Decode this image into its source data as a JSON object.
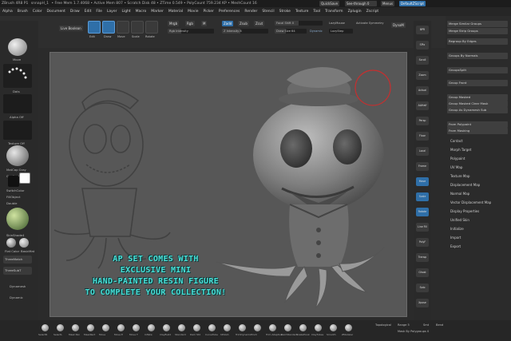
{
  "titlebar": {
    "app": "ZBrush 4R8 P1",
    "doc": "snnapH_1",
    "free_mem": "• Free Mem 1.7.4068 • Active Mem 807 • Scratch Disk 48 • ZTime 0.549 • PolyCount 759.234 KP • MeshCount 16",
    "quicksave": "QuickSave",
    "see_through": "See-through  0",
    "menus_label": "Menus",
    "script": "DefaultZScript"
  },
  "menubar": [
    "Alpha",
    "Brush",
    "Color",
    "Document",
    "Draw",
    "Edit",
    "File",
    "Layer",
    "Light",
    "Macro",
    "Marker",
    "Material",
    "Movie",
    "Picker",
    "Preferences",
    "Render",
    "Stencil",
    "Stroke",
    "Texture",
    "Tool",
    "Transform",
    "Zplugin",
    "Zscript"
  ],
  "toolbar": {
    "active_points": "ActivePoints: 14,921",
    "total_points": "TotalPoints: 759,176",
    "live_boolean": "Live Boolean",
    "edit": "Edit",
    "draw": "Draw",
    "move": "Move",
    "scale": "Scale",
    "rotate": "Rotate",
    "mrgb": "Mrgb",
    "rgb": "Rgb",
    "m": "M",
    "zadd": "Zadd",
    "zsub": "Zsub",
    "zcut": "Zcut",
    "rgb_intensity": "Rgb Intensity",
    "z_intensity": "Z Intensity  8",
    "focal_shift": "Focal Shift  0",
    "draw_size": "Draw Size  64",
    "dynamic": "Dynamic",
    "lazymouse": "LazyMouse",
    "activate_symmetry": "Activate Symmetry",
    "lazy_step": "LazyStep",
    "dynamesh": "DynaM"
  },
  "leftshelf": {
    "brush": "Move",
    "stroke": "Dots",
    "alpha": "Alpha Off",
    "texture": "Texture Off",
    "material": "MatCap Gray",
    "gradient": "Gradient",
    "switch_color": "SwitchColor",
    "alternate": "FillObject",
    "double": "Double",
    "lightbox": "SkinShade4",
    "flat_color": "Flat Color",
    "basic_material": "BasicMat",
    "items": [
      "ThreeMatch",
      "ThreeSubT",
      "Dynamesh",
      "Dynamic"
    ]
  },
  "rightstrip": [
    "BPR",
    "SPix",
    "Scroll",
    "Zoom",
    "Actual",
    "AAHalf",
    "Persp",
    "Floor",
    "Local",
    "Frame",
    "Move",
    "Scale",
    "Rotate",
    "Line Fill",
    "PolyF",
    "Transp",
    "Ghost",
    "Solo",
    "Xpose"
  ],
  "rightpanel": {
    "buttons": [
      "Merge Similar Groups",
      "Merge Strip Groups",
      "Regroup By Edges",
      "Groups By Normals",
      "GroupsSplit",
      "Group Front",
      "Group Masked",
      "Group Masked Clear Mask",
      "Group As Dynamesh Sub",
      "From Polypaint",
      "From Masking"
    ]
  },
  "rightmenu": [
    "Contact",
    "Morph Target",
    "Polypaint",
    "UV Map",
    "Texture Map",
    "Displacement Map",
    "Normal Map",
    "Vector Displacement Map",
    "Display Properties",
    "Unified Skin",
    "Initialize",
    "Import",
    "Export"
  ],
  "bottombar": {
    "brushes": [
      "SelectR",
      "SelectL",
      "Mask Pen",
      "MaskRect",
      "Move",
      "Move E",
      "Move T",
      "Inflate",
      "ClayBuild",
      "Standard",
      "Dam Std",
      "CurveTube",
      "hPolish",
      "TrimDynamic",
      "Pinch",
      "Trim Adaptive",
      "DamStandard",
      "SnakeHook",
      "ClayTubes",
      "Smooth",
      "ZModeler"
    ],
    "topological": "Topological",
    "range": "Range  5",
    "smt": "Smt",
    "bend": "Bend",
    "mask_by_polygroups": "Mask By Polygroups  0"
  },
  "promo": {
    "line1": "AP SET COMES WITH",
    "line2": "EXCLUSIVE MINI",
    "line3": "HAND-PAINTED RESIN FIGURE",
    "line4": "TO COMPLETE YOUR COLLECTION!"
  },
  "colors": {
    "accent": "#2f6fa8",
    "promo_text": "#48e0d8",
    "brush_cursor": "#c23030"
  }
}
